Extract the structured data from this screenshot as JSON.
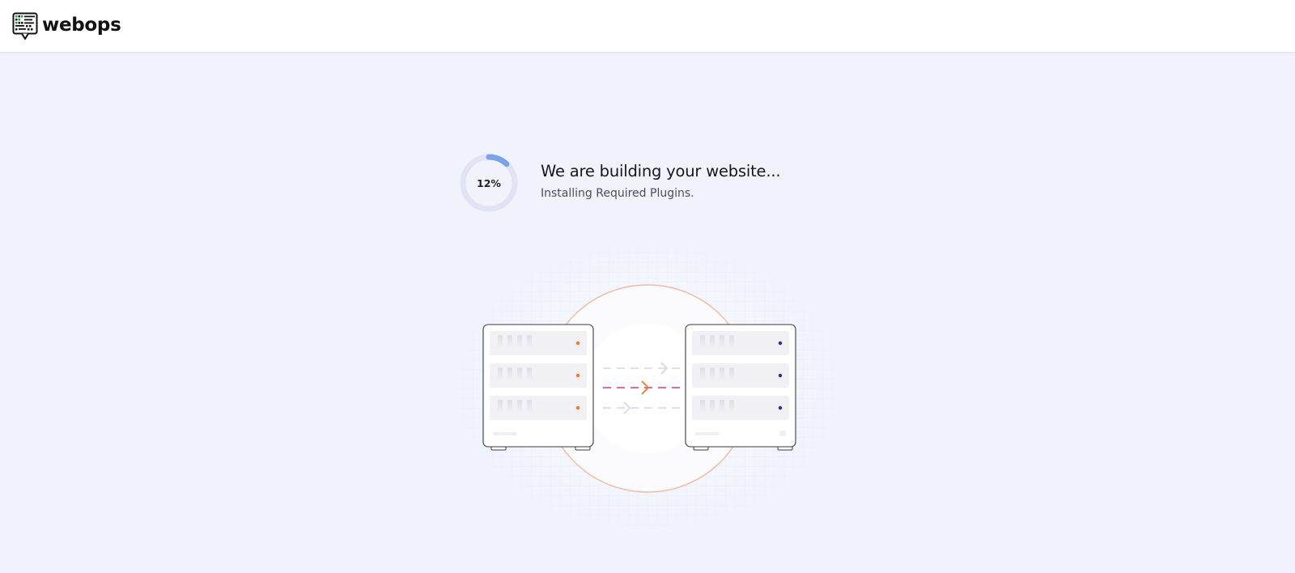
{
  "header": {
    "brand": "webops"
  },
  "progress": {
    "percent": 12,
    "label": "12%",
    "title": "We are building your website...",
    "subtitle": "Installing Required Plugins."
  },
  "colors": {
    "page_bg": "#f0f3fc",
    "ring_track": "#dfe3f3",
    "ring_fill": "#7aa2ef",
    "accent_orange": "#ee7a1b",
    "accent_pink": "#d9368a",
    "accent_navy": "#2b2d8f"
  },
  "icons": {
    "logo": "webops-logo-icon",
    "server_left": "source-server-icon",
    "server_right": "destination-server-icon"
  }
}
